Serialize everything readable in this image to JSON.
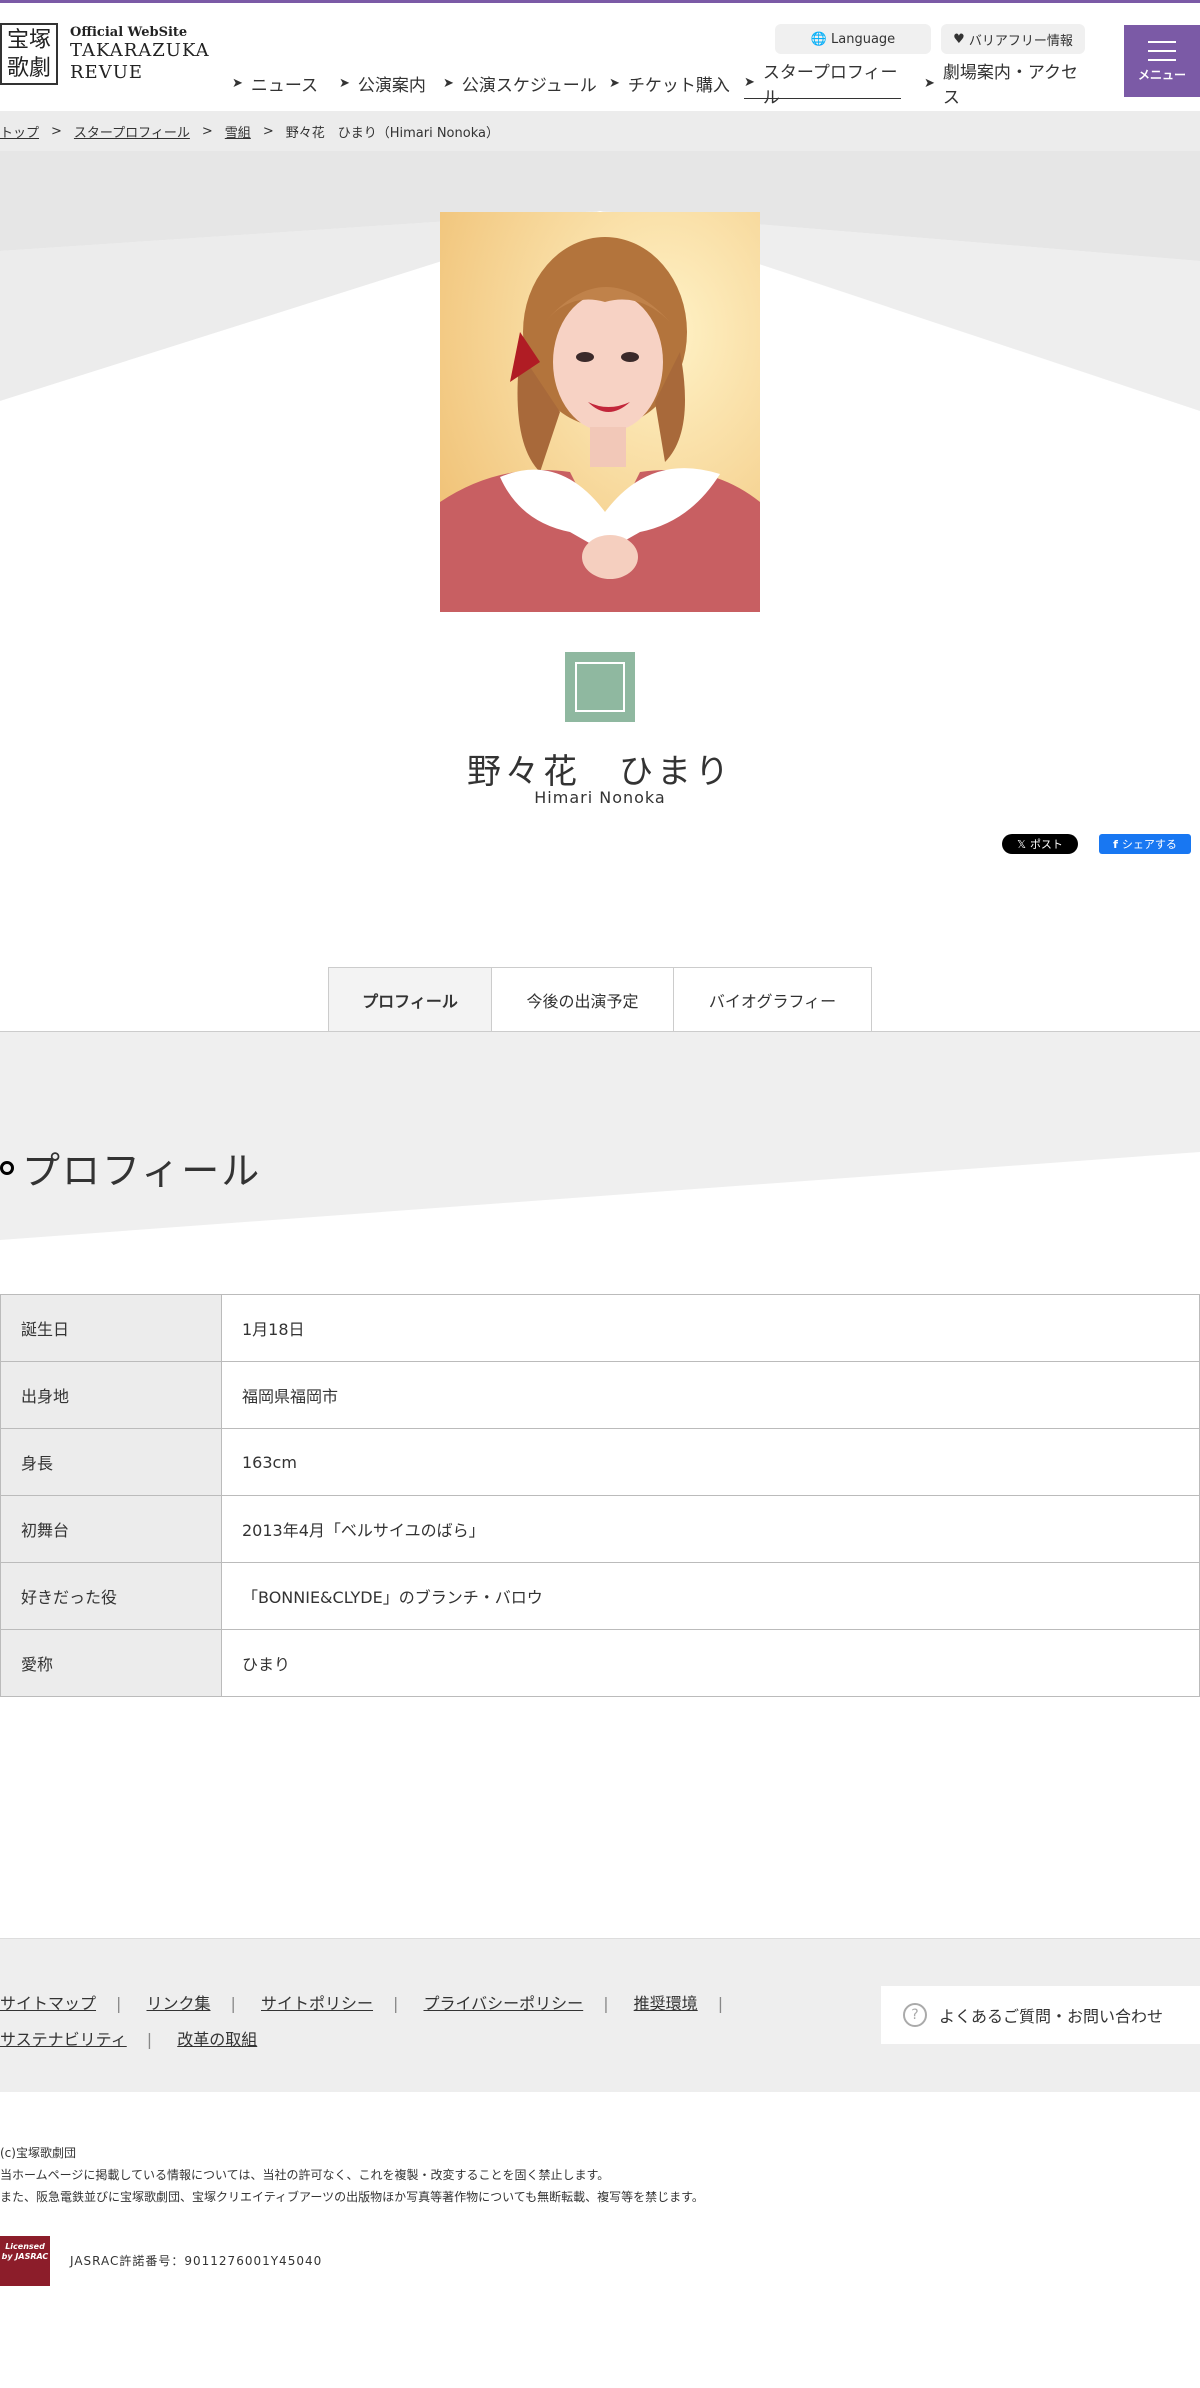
{
  "header": {
    "logo_kanji_line1": "宝塚",
    "logo_kanji_line2": "歌劇",
    "logo_small": "Official WebSite",
    "logo_title_line1": "TAKARAZUKA",
    "logo_title_line2": "REVUE",
    "language_label": "Language",
    "barrier_free_label": "バリアフリー情報",
    "menu_label": "メニュー",
    "nav": [
      {
        "label": "ニュース"
      },
      {
        "label": "公演案内"
      },
      {
        "label": "公演スケジュール"
      },
      {
        "label": "チケット購入"
      },
      {
        "label": "スタープロフィール"
      },
      {
        "label": "劇場案内・アクセス"
      }
    ]
  },
  "breadcrumb": {
    "items": [
      "トップ",
      "スタープロフィール",
      "雪組",
      "野々花　ひまり（Himari Nonoka）"
    ],
    "separator": ">"
  },
  "profile": {
    "name_jp": "野々花　ひまり",
    "name_en": "Himari Nonoka",
    "troupe_color": "#8fb8a0"
  },
  "sns": {
    "x_label": "ポスト",
    "fb_label": "シェアする"
  },
  "tabs": [
    {
      "label": "プロフィール"
    },
    {
      "label": "今後の出演予定"
    },
    {
      "label": "バイオグラフィー"
    }
  ],
  "section_title": "プロフィール",
  "table": [
    {
      "label": "誕生日",
      "value": "1月18日"
    },
    {
      "label": "出身地",
      "value": "福岡県福岡市"
    },
    {
      "label": "身長",
      "value": "163cm"
    },
    {
      "label": "初舞台",
      "value": "2013年4月「ベルサイユのばら」"
    },
    {
      "label": "好きだった役",
      "value": "「BONNIE&CLYDE」のブランチ・バロウ"
    },
    {
      "label": "愛称",
      "value": "ひまり"
    }
  ],
  "footer": {
    "links_row1": [
      "サイトマップ",
      "リンク集",
      "サイトポリシー",
      "プライバシーポリシー",
      "推奨環境"
    ],
    "links_row2": [
      "サステナビリティ",
      "改革の取組"
    ],
    "faq_label": "よくあるご質問・お問い合わせ",
    "copyright": "(c)宝塚歌劇団",
    "notice1": "当ホームページに掲載している情報については、当社の許可なく、これを複製・改変することを固く禁止します。",
    "notice2": "また、阪急電鉄並びに宝塚歌劇団、宝塚クリエイティブアーツの出版物ほか写真等著作物についても無断転載、複写等を禁じます。",
    "jasrac_logo_text": "Licensed by JASRAC",
    "jasrac": "JASRAC許諾番号：9011276001Y45040"
  },
  "colors": {
    "brand": "#7b5aa6",
    "facebook": "#1877f2"
  }
}
